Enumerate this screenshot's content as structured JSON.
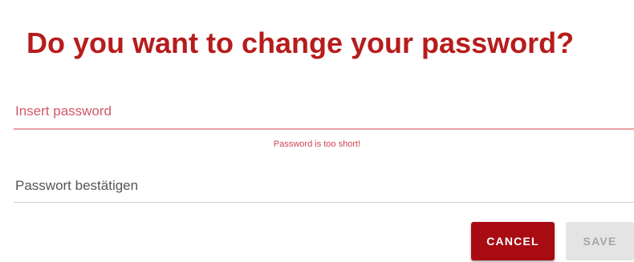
{
  "dialog": {
    "title": "Do you want to change your password?",
    "password_field": {
      "placeholder": "Insert password",
      "value": "",
      "error": "Password is too short!"
    },
    "confirm_field": {
      "placeholder": "Passwort bestätigen",
      "value": ""
    },
    "buttons": {
      "cancel_label": "CANCEL",
      "save_label": "SAVE",
      "save_disabled": true
    }
  },
  "colors": {
    "accent": "#b71c1c",
    "primary_button": "#a80c12",
    "error_text": "#d24450",
    "disabled_button": "#e4e4e4",
    "disabled_text": "#a6a6a6"
  }
}
